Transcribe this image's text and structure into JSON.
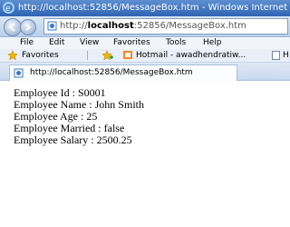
{
  "window": {
    "title": "http://localhost:52856/MessageBox.htm - Windows Internet"
  },
  "address_bar": {
    "prefix": "http://",
    "host": "localhost",
    "rest": ":52856/MessageBox.htm"
  },
  "menu": [
    "File",
    "Edit",
    "View",
    "Favorites",
    "Tools",
    "Help"
  ],
  "favorites_bar": {
    "label": "Favorites",
    "hotmail_label": "Hotmail - awadhendratiw...",
    "right_label": "H"
  },
  "tab": {
    "title": "http://localhost:52856/MessageBox.htm"
  },
  "employee": {
    "id_line": "Employee Id : S0001",
    "name_line": "Employee Name : John Smith",
    "age_line": "Employee Age : 25",
    "married_line": "Employee Married : false",
    "salary_line": "Employee Salary : 2500.25"
  },
  "icons": [
    "ie-logo-icon",
    "back-arrow-icon",
    "forward-arrow-icon",
    "page-icon",
    "favorites-star-icon",
    "add-favorite-icon",
    "hotmail-icon"
  ],
  "colors": {
    "titlebar": "#2f64b3",
    "toolbar": "#dbe8f7",
    "menubar": "#f1f4f9"
  }
}
